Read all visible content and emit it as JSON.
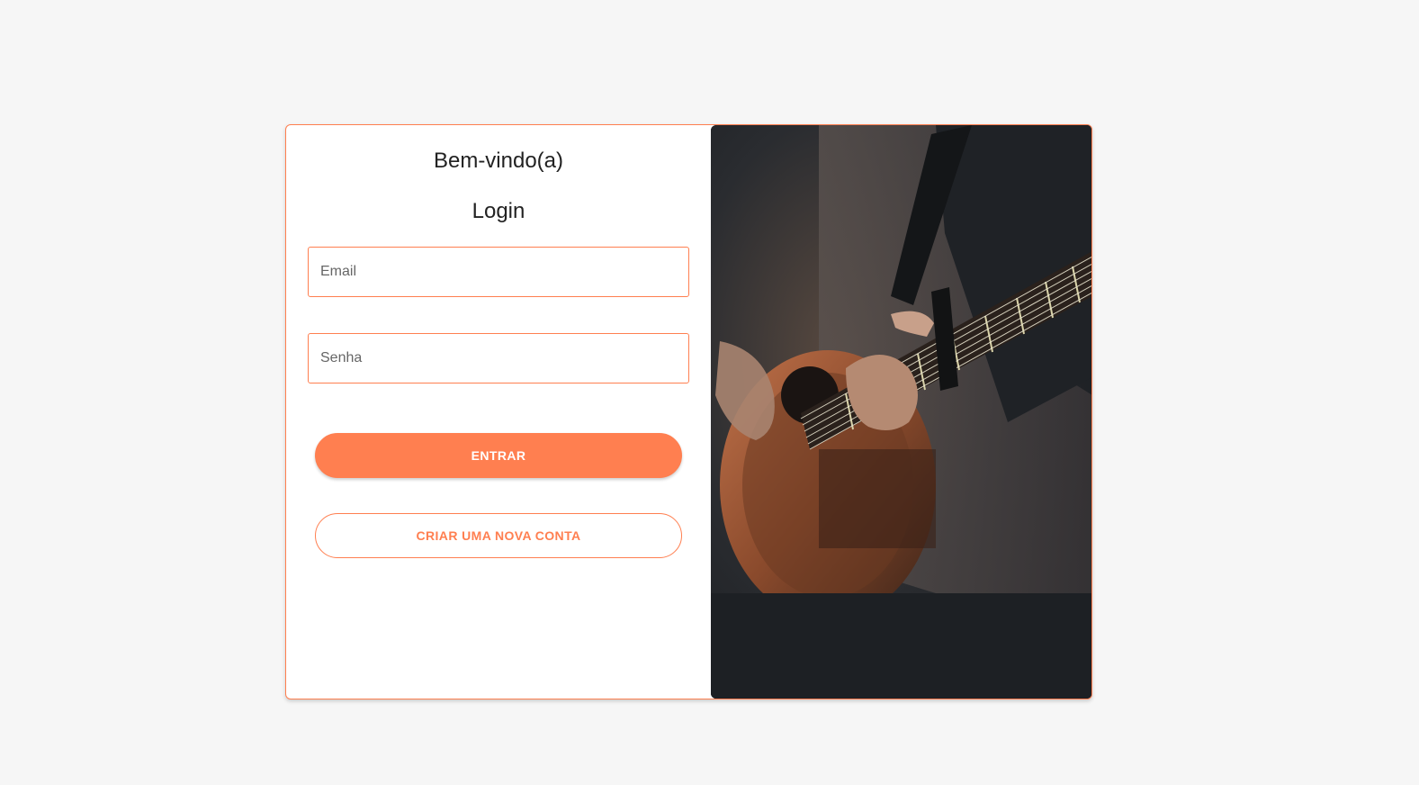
{
  "login": {
    "welcome": "Bem-vindo(a)",
    "title": "Login",
    "email_placeholder": "Email",
    "password_placeholder": "Senha",
    "submit_label": "ENTRAR",
    "create_account_label": "CRIAR UMA NOVA CONTA"
  },
  "image": {
    "subject": "guitarist-playing-acoustic-guitar"
  },
  "colors": {
    "accent": "#ff7f50",
    "background": "#f6f6f6",
    "card": "#ffffff"
  }
}
